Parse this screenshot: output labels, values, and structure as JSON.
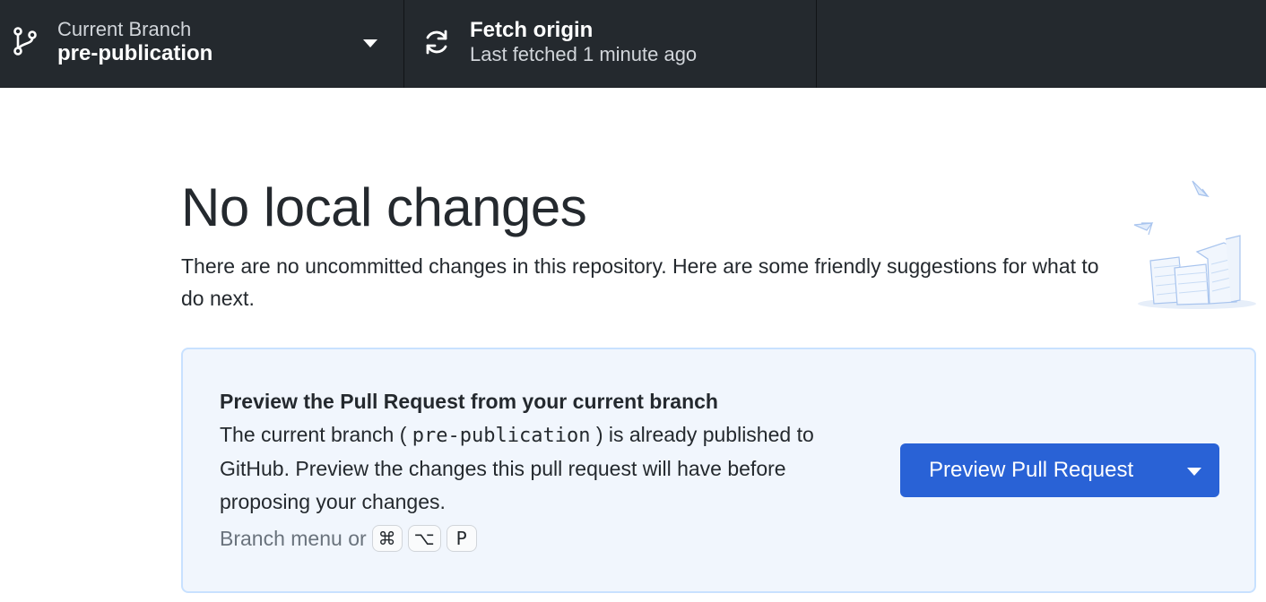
{
  "toolbar": {
    "branch": {
      "label": "Current Branch",
      "value": "pre-publication",
      "icon": "git-branch-icon"
    },
    "fetch": {
      "label": "Fetch origin",
      "status": "Last fetched 1 minute ago",
      "icon": "sync-icon"
    }
  },
  "main": {
    "heading": "No local changes",
    "subtext": "There are no uncommitted changes in this repository. Here are some friendly suggestions for what to do next.",
    "card": {
      "title": "Preview the Pull Request from your current branch",
      "desc_pre": "The current branch ( ",
      "branch": "pre-publication",
      "desc_post": " ) is already published to GitHub. Preview the changes this pull request will have before proposing your changes.",
      "shortcut_prefix": "Branch menu or",
      "shortcut_keys": [
        "⌘",
        "⌥",
        "P"
      ],
      "button_label": "Preview Pull Request"
    }
  },
  "colors": {
    "toolbar_bg": "#24292e",
    "card_bg": "#f1f6fd",
    "card_border": "#c8e1ff",
    "button_bg": "#2962d6"
  }
}
